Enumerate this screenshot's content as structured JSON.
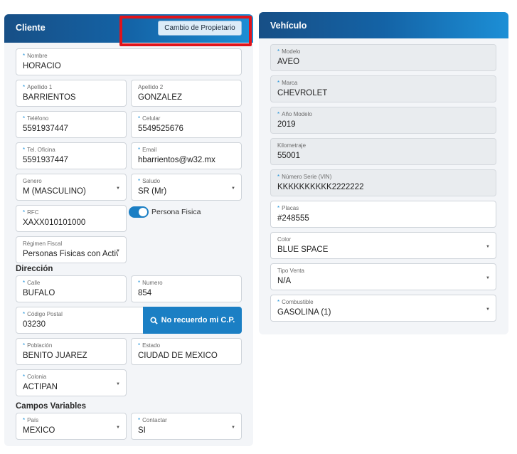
{
  "cliente": {
    "title": "Cliente",
    "owner_change_button": "Cambio de Propietario",
    "nombre": {
      "label": "Nombre",
      "value": "HORACIO"
    },
    "apellido1": {
      "label": "Apellido 1",
      "value": "BARRIENTOS"
    },
    "apellido2": {
      "label": "Apellido 2",
      "value": "GONZALEZ"
    },
    "telefono": {
      "label": "Teléfono",
      "value": "5591937447"
    },
    "celular": {
      "label": "Celular",
      "value": "5549525676"
    },
    "tel_oficina": {
      "label": "Tel. Oficina",
      "value": "5591937447"
    },
    "email": {
      "label": "Email",
      "value": "hbarrientos@w32.mx"
    },
    "genero": {
      "label": "Genero",
      "value": "M (MASCULINO)"
    },
    "saludo": {
      "label": "Saludo",
      "value": "SR (Mr)"
    },
    "rfc": {
      "label": "RFC",
      "value": "XAXX010101000"
    },
    "persona_fisica": {
      "label": "Persona Fisica",
      "on": true
    },
    "regimen_fiscal": {
      "label": "Régimen Fiscal",
      "value": "Personas Fisicas con Activ"
    }
  },
  "direccion": {
    "title": "Dirección",
    "calle": {
      "label": "Calle",
      "value": "BUFALO"
    },
    "numero": {
      "label": "Numero",
      "value": "854"
    },
    "codigo_postal": {
      "label": "Código Postal",
      "value": "03230"
    },
    "cp_button": "No recuerdo mi C.P.",
    "poblacion": {
      "label": "Población",
      "value": "BENITO JUÁREZ"
    },
    "estado": {
      "label": "Estado",
      "value": "CIUDAD DE MÉXICO"
    },
    "colonia": {
      "label": "Colonia",
      "value": "ACTIPAN"
    }
  },
  "campos_variables": {
    "title": "Campos Variables",
    "pais": {
      "label": "País",
      "value": "MEXICO"
    },
    "contactar": {
      "label": "Contactar",
      "value": "SI"
    }
  },
  "vehiculo": {
    "title": "Vehículo",
    "modelo": {
      "label": "Modelo",
      "value": "AVEO"
    },
    "marca": {
      "label": "Marca",
      "value": "CHEVROLET"
    },
    "anio_modelo": {
      "label": "Año Modelo",
      "value": "2019"
    },
    "kilometraje": {
      "label": "Kilometraje",
      "value": "55001"
    },
    "numero_serie": {
      "label": "Número Serie (VIN)",
      "value": "KKKKKKKKKK2222222"
    },
    "placas": {
      "label": "Placas",
      "value": "#248555"
    },
    "color": {
      "label": "Color",
      "value": "BLUE SPACE"
    },
    "tipo_venta": {
      "label": "Tipo Venta",
      "value": "N/A"
    },
    "combustible": {
      "label": "Combustible",
      "value": "GASOLINA (1)"
    }
  },
  "colors": {
    "accent": "#1b7fc4",
    "header_start": "#174f86",
    "header_end": "#1c8fd6",
    "highlight": "#e0141b"
  }
}
